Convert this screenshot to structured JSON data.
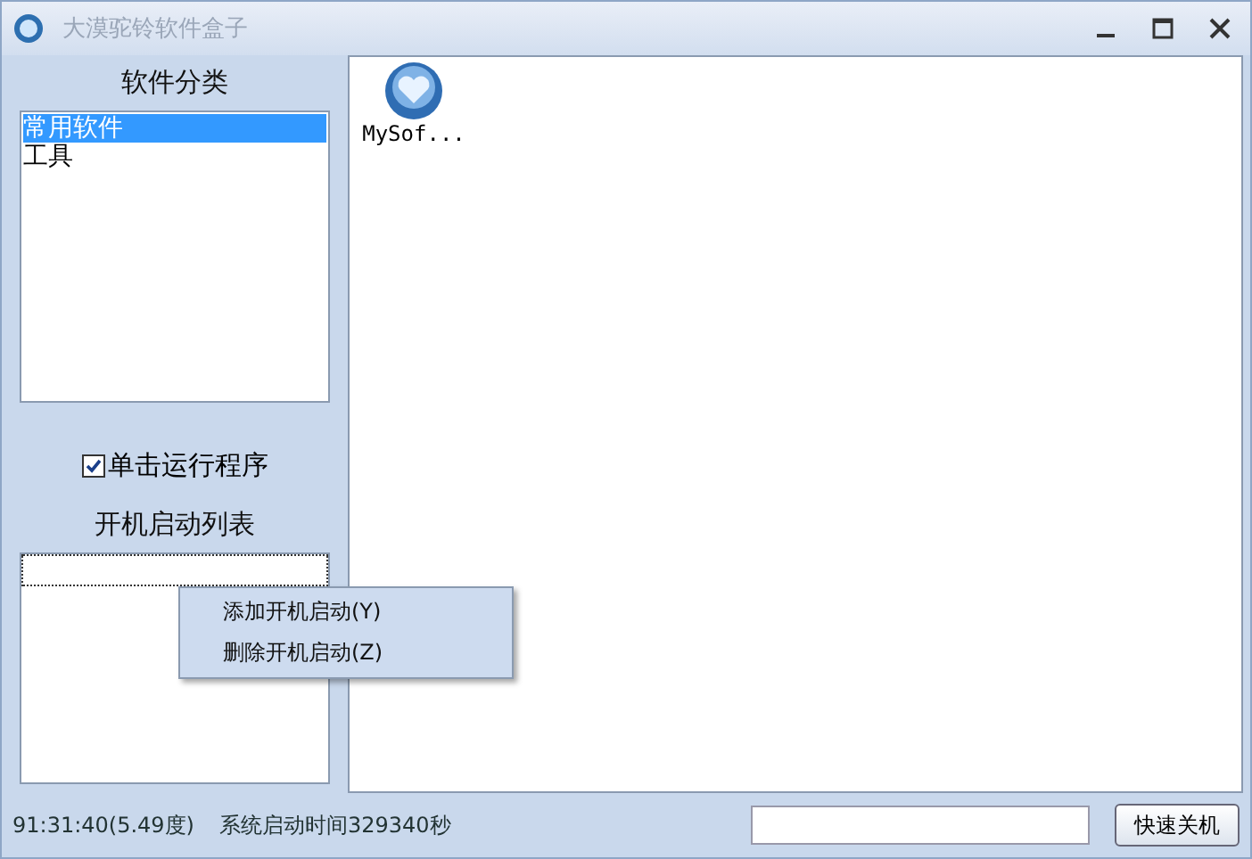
{
  "window": {
    "title": "大漠驼铃软件盒子"
  },
  "categories": {
    "title": "软件分类",
    "items": [
      {
        "label": "常用软件",
        "selected": true
      },
      {
        "label": "工具",
        "selected": false
      }
    ]
  },
  "single_click": {
    "label": "单击运行程序",
    "checked": true
  },
  "startup": {
    "title": "开机启动列表",
    "items": [
      {
        "focused": true
      }
    ]
  },
  "context_menu": [
    {
      "label": "添加开机启动(Y)"
    },
    {
      "label": "删除开机启动(Z)"
    }
  ],
  "apps": [
    {
      "label": "MySof..."
    }
  ],
  "status_bar": {
    "time": "91:31:40(5.49度)",
    "uptime": "系统启动时间329340秒",
    "button": "快速关机"
  }
}
